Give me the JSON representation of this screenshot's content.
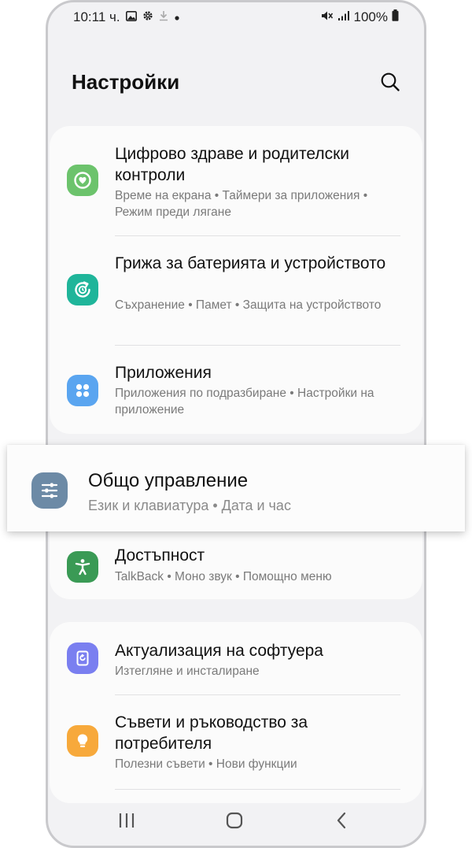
{
  "status_bar": {
    "time": "10:11 ч.",
    "battery": "100%",
    "icons": [
      "image-icon",
      "gear-icon",
      "download-icon",
      "dot-icon",
      "mute-icon",
      "signal-icon",
      "battery-icon"
    ]
  },
  "header": {
    "title": "Настройки",
    "search_icon": "search-icon"
  },
  "groups": [
    {
      "items": [
        {
          "title": "Цифрово здраве и родителски контроли",
          "subtitle": "Време на екрана • Таймери за приложения • Режим преди лягане",
          "icon": "digital-wellbeing-icon",
          "color": "#6cc36c"
        },
        {
          "title": "Грижа за батерията и устройството",
          "subtitle": "Съхранение • Памет • Защита на устройството",
          "icon": "device-care-icon",
          "color": "#1fb59a"
        },
        {
          "title": "Приложения",
          "subtitle": "Приложения по подразбиране • Настройки на приложение",
          "icon": "apps-icon",
          "color": "#5aa5f0"
        }
      ]
    },
    {
      "items": [
        {
          "title": "Общо управление",
          "subtitle": "Език и клавиатура • Дата и час",
          "icon": "general-management-icon",
          "color": "#6c8aa6",
          "highlighted": true
        },
        {
          "title": "Достъпност",
          "subtitle": "TalkBack • Моно звук • Помощно меню",
          "icon": "accessibility-icon",
          "color": "#3a9a55"
        }
      ]
    },
    {
      "items": [
        {
          "title": "Актуализация на софтуера",
          "subtitle": "Изтегляне и инсталиране",
          "icon": "software-update-icon",
          "color": "#7a7ff0"
        },
        {
          "title": "Съвети и ръководство за потребителя",
          "subtitle": "Полезни съвети • Нови функции",
          "icon": "tips-icon",
          "color": "#f7a93b"
        }
      ]
    }
  ],
  "nav_bar": {
    "icons": [
      "recents-icon",
      "home-icon",
      "back-icon"
    ]
  }
}
